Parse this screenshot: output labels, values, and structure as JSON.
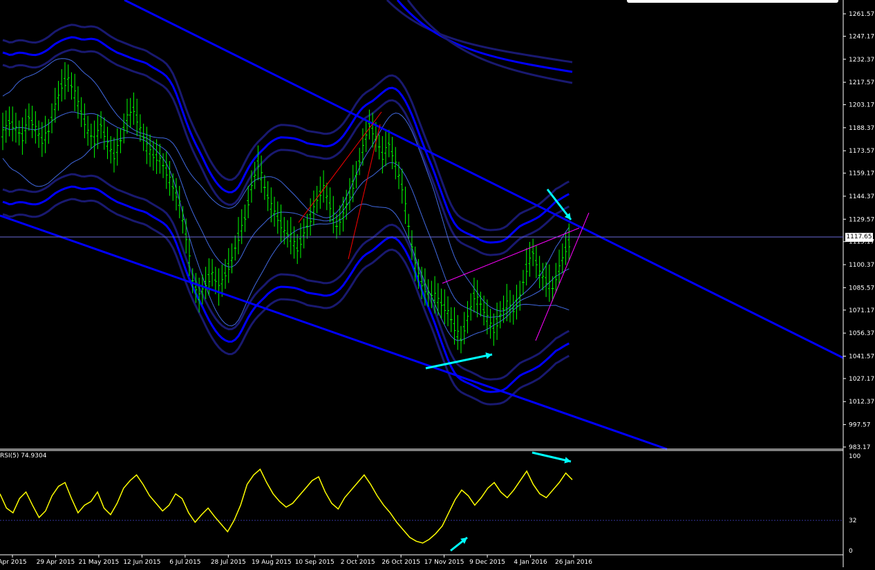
{
  "chart_data": [
    {
      "type": "ohlc-bar",
      "instrument_last_price": "1117.65",
      "y_axis_ticks": [
        "1261.57",
        "1247.17",
        "1232.37",
        "1217.57",
        "1203.17",
        "1188.37",
        "1173.57",
        "1159.17",
        "1144.37",
        "1129.57",
        "1115.17",
        "1100.37",
        "1085.57",
        "1071.17",
        "1056.37",
        "1041.57",
        "1027.17",
        "1012.37",
        "997.57",
        "983.17"
      ],
      "ylim": [
        983.17,
        1261.57
      ],
      "x_axis_ticks": [
        "Apr 2015",
        "29 Apr 2015",
        "21 May 2015",
        "12 Jun 2015",
        "6 Jul 2015",
        "28 Jul 2015",
        "19 Aug 2015",
        "10 Sep 2015",
        "2 Oct 2015",
        "26 Oct 2015",
        "17 Nov 2015",
        "9 Dec 2015",
        "4 Jan 2016",
        "26 Jan 2016"
      ],
      "price_path": [
        1185,
        1192,
        1188,
        1182,
        1195,
        1188,
        1180,
        1186,
        1202,
        1215,
        1220,
        1210,
        1198,
        1186,
        1180,
        1190,
        1178,
        1170,
        1180,
        1195,
        1200,
        1188,
        1176,
        1170,
        1168,
        1160,
        1150,
        1140,
        1118,
        1090,
        1080,
        1088,
        1095,
        1085,
        1094,
        1104,
        1118,
        1130,
        1150,
        1165,
        1150,
        1138,
        1130,
        1122,
        1118,
        1110,
        1120,
        1130,
        1142,
        1150,
        1138,
        1125,
        1132,
        1145,
        1158,
        1175,
        1190,
        1182,
        1170,
        1178,
        1165,
        1150,
        1125,
        1100,
        1088,
        1082,
        1080,
        1075,
        1070,
        1060,
        1052,
        1066,
        1080,
        1075,
        1066,
        1058,
        1068,
        1075,
        1071,
        1080,
        1098,
        1108,
        1095,
        1090,
        1085,
        1098,
        1110,
        1117.65
      ],
      "last_close": 1117.65
    },
    {
      "type": "line",
      "label": "RSI(5) 74.9304",
      "y_axis_ticks": [
        "100",
        "32",
        "0"
      ],
      "ylim": [
        0,
        100
      ],
      "level": 32,
      "series": [
        {
          "values": [
            60,
            45,
            40,
            55,
            62,
            48,
            35,
            42,
            58,
            68,
            72,
            55,
            40,
            48,
            52,
            62,
            45,
            38,
            50,
            66,
            74,
            80,
            70,
            58,
            50,
            42,
            48,
            60,
            55,
            40,
            30,
            38,
            45,
            36,
            28,
            20,
            32,
            48,
            70,
            80,
            86,
            72,
            60,
            52,
            46,
            50,
            58,
            66,
            74,
            78,
            62,
            50,
            44,
            56,
            64,
            72,
            80,
            70,
            58,
            48,
            40,
            30,
            22,
            14,
            10,
            8,
            12,
            18,
            26,
            40,
            54,
            64,
            58,
            48,
            56,
            66,
            72,
            62,
            56,
            64,
            74,
            84,
            70,
            60,
            56,
            64,
            72,
            82,
            74.93
          ]
        }
      ]
    }
  ],
  "page": {
    "last_price_tag": "1117.65",
    "rsi_label": "RSI(5) 74.9304"
  },
  "colors": {
    "background": "#000000",
    "bars": "#00ff00",
    "channel": "#0000ff",
    "envelope": "#191970",
    "bollinger": "#4169e1",
    "rsi": "#ffff00",
    "arrows": "#00ffff",
    "trend_red": "#ff0000",
    "trend_magenta": "#ff00ff",
    "axis_text": "#ffffff"
  }
}
